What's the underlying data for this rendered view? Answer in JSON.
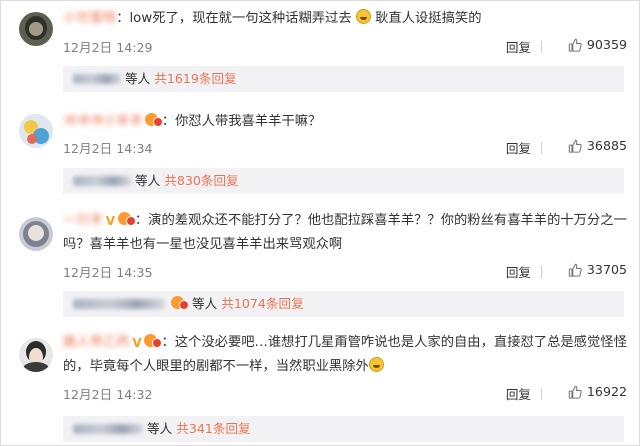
{
  "comments": [
    {
      "text": "：low死了，现在就一句这种话糊弄过去",
      "text_after_emoji": "耿直人设挺搞笑的",
      "time": "12月2日 14:29",
      "reply": "回复",
      "likes": "90359",
      "sub": {
        "suffix": "等人",
        "count": "共1619条回复"
      }
    },
    {
      "text": "：你怼人带我喜羊羊干嘛？",
      "time": "12月2日 14:34",
      "reply": "回复",
      "likes": "36885",
      "sub": {
        "suffix": "等人",
        "count": "共830条回复"
      }
    },
    {
      "text_line1": "：演的差观众还不能打分了？他也配拉踩喜羊羊？？你的粉丝有喜羊羊的十万分之一",
      "text_line2": "吗？喜羊羊也有一星也没见喜羊羊出来骂观众啊",
      "time": "12月2日 14:35",
      "reply": "回复",
      "likes": "33705",
      "sub": {
        "suffix": "等人",
        "count": "共1074条回复"
      }
    },
    {
      "text_line1": "：这个没必要吧…谁想打几星甭管咋说也是人家的自由，直接怼了总是感觉怪怪",
      "text_line2": "的，毕竟每个人眼里的剧都不一样，当然职业黑除外",
      "time": "12月2日 14:32",
      "reply": "回复",
      "likes": "16922",
      "sub": {
        "suffix": "等人",
        "count": "共341条回复"
      }
    }
  ],
  "icons": {
    "like": "thumbs-up-icon",
    "emoji": "laughing-emoji-icon",
    "badge": "vip-badge-icon"
  },
  "colors": {
    "accent": "#eb7350",
    "muted": "#808080",
    "subbox": "#f2f2f5"
  }
}
